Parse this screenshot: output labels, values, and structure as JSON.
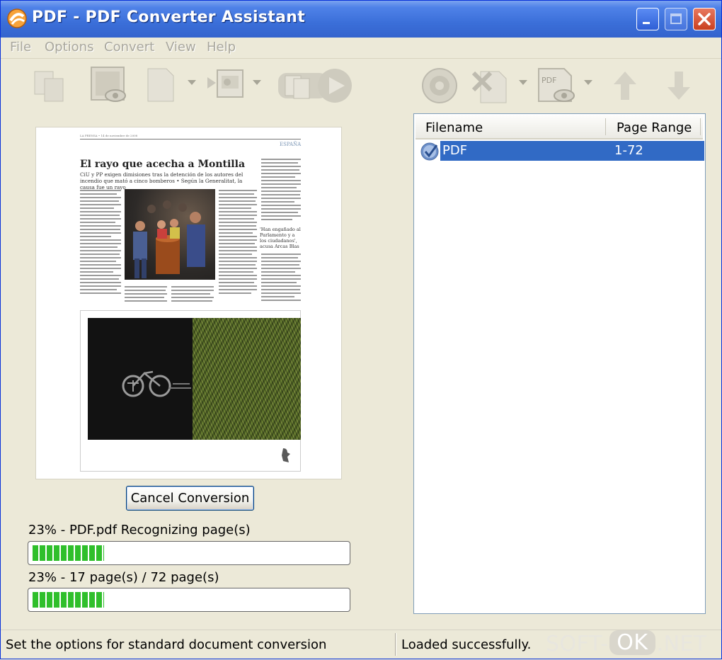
{
  "window": {
    "title": "PDF - PDF Converter Assistant",
    "controls": {
      "minimize": "minimize-icon",
      "maximize": "maximize-icon",
      "close": "close-icon"
    }
  },
  "menu": [
    "File",
    "Options",
    "Convert",
    "View",
    "Help"
  ],
  "toolbar": {
    "icons": [
      "open-files-icon",
      "preview-icon",
      "page-icon",
      "layout-icon",
      "start-conversion-icon",
      "settings-icon",
      "remove-icon",
      "pdf-preview-icon",
      "move-up-icon",
      "move-down-icon"
    ],
    "enabled": false
  },
  "preview": {
    "page_header": "LA PRENSA • 14 de noviembre de 2008",
    "section": "ESPAÑA",
    "headline": "El rayo que acecha a Montilla",
    "deck": "CiU y PP exigen dimisiones tras la detención de los autores del incendio que mató a cinco bomberos • Según la Generalitat, la causa fue un rayo",
    "quote": "'Han engañado al Parlamento y a los ciudadanos', acusa Arcas Blas"
  },
  "cancel_button": "Cancel Conversion",
  "progress": [
    {
      "label": "23% - PDF.pdf Recognizing page(s)",
      "percent": 23
    },
    {
      "label": "23% - 17 page(s) / 72 page(s)",
      "percent": 23
    }
  ],
  "file_list": {
    "columns": [
      "Filename",
      "Page Range"
    ],
    "rows": [
      {
        "filename": "PDF",
        "page_range": "1-72",
        "selected": true,
        "icon": "checkmark-icon"
      }
    ]
  },
  "status": {
    "left": "Set the options for standard document conversion",
    "right": "Loaded successfully."
  },
  "watermark": {
    "a": "SOFT-",
    "b": "OK",
    "c": ".NET"
  },
  "colors": {
    "titlebar": "#3b6fd9",
    "selection": "#316ac5",
    "progress": "#2fbf2b",
    "window_bg": "#ece9d8"
  }
}
